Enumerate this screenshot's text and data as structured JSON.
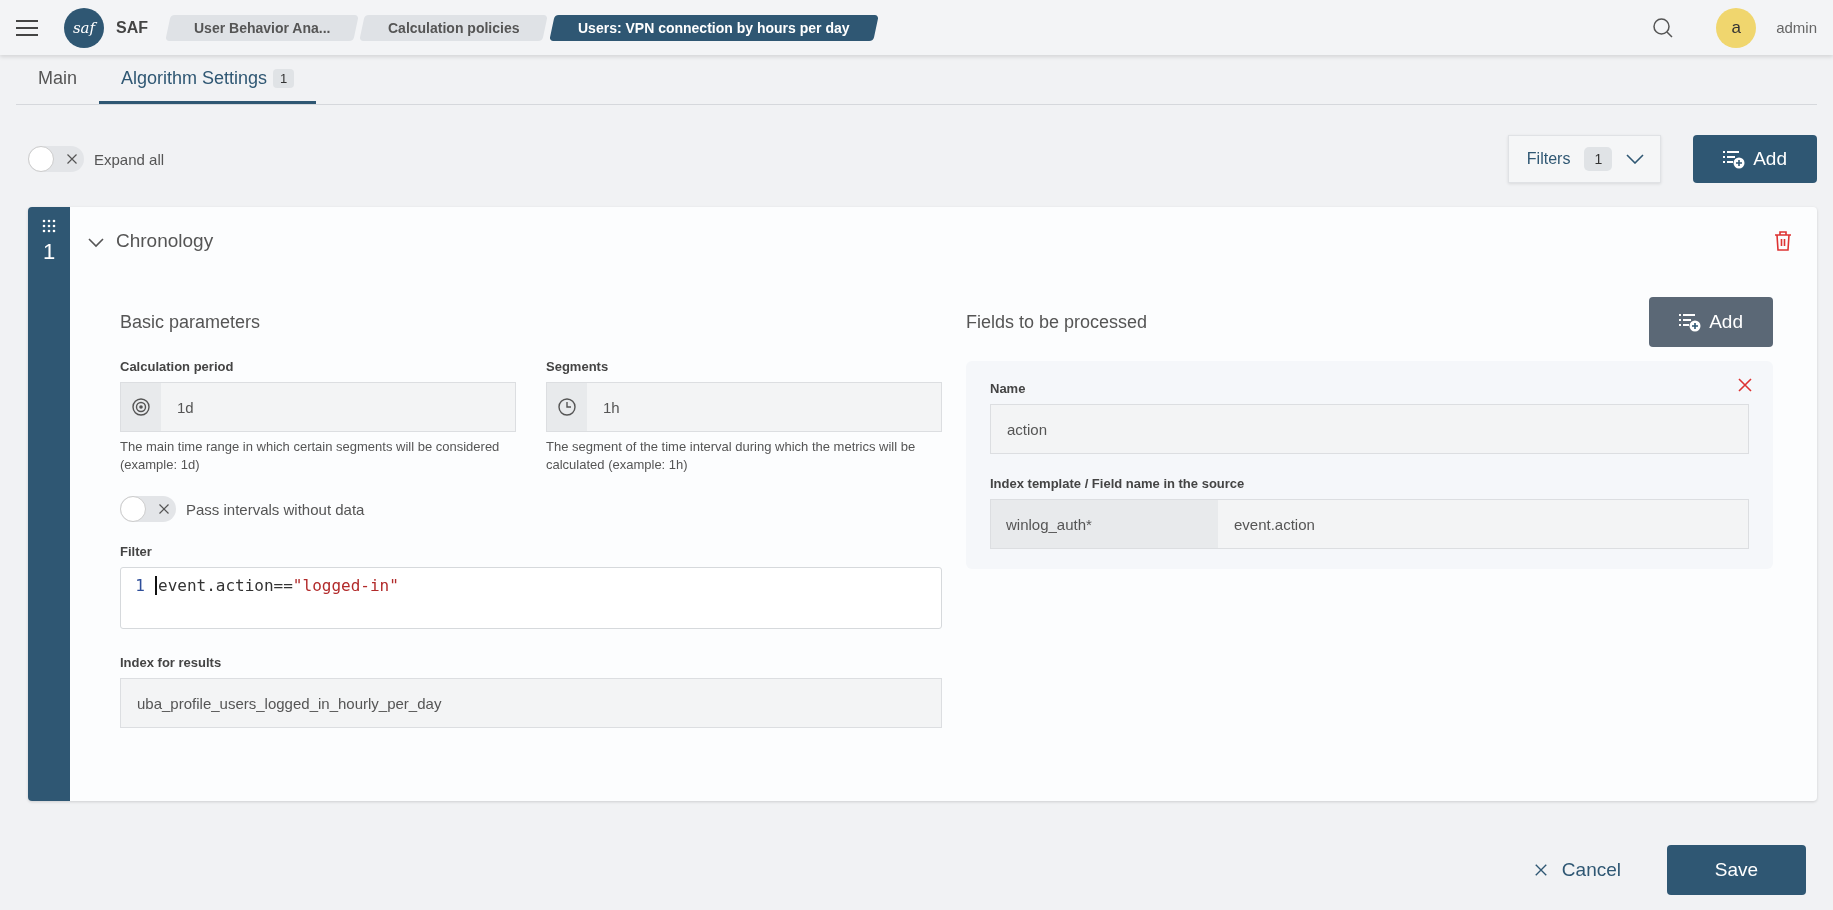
{
  "app": {
    "name": "SAF",
    "logo_text": "saf"
  },
  "breadcrumbs": [
    {
      "label": "User Behavior Ana...",
      "selected": false
    },
    {
      "label": "Calculation policies",
      "selected": false
    },
    {
      "label": "Users: VPN connection by hours per day",
      "selected": true
    }
  ],
  "user": {
    "avatar_letter": "a",
    "name": "admin"
  },
  "tabs": [
    {
      "label": "Main",
      "selected": false
    },
    {
      "label": "Algorithm Settings",
      "badge": "1",
      "selected": true
    }
  ],
  "toolbar": {
    "expand_all": {
      "label": "Expand all",
      "on": false
    },
    "filters": {
      "label": "Filters",
      "count": "1"
    },
    "add_button": "Add"
  },
  "sections": [
    {
      "number": "1",
      "title": "Chronology",
      "expanded": true,
      "basic": {
        "title": "Basic parameters",
        "fields": [
          {
            "label": "Calculation period",
            "value": "1d",
            "hint": "The main time range in which certain segments will be considered (example: 1d)"
          },
          {
            "label": "Segments",
            "value": "1h",
            "hint": "The segment of the time interval during which the metrics will be calculated (example: 1h)"
          }
        ],
        "pass_intervals": {
          "label": "Pass intervals without data",
          "on": false
        },
        "filter": {
          "label": "Filter",
          "line_number": "1",
          "code_key": "event.action==",
          "code_string": "\"logged-in\""
        },
        "index": {
          "label": "Index for results",
          "value": "uba_profile_users_logged_in_hourly_per_day"
        }
      },
      "fields_panel": {
        "title": "Fields to be processed",
        "add_button": "Add",
        "items": [
          {
            "name_label": "Name",
            "name_value": "action",
            "source_label": "Index template / Field name in the source",
            "index_template": "winlog_auth*",
            "field_name": "event.action"
          }
        ]
      }
    }
  ],
  "footer": {
    "cancel": "Cancel",
    "save": "Save"
  }
}
